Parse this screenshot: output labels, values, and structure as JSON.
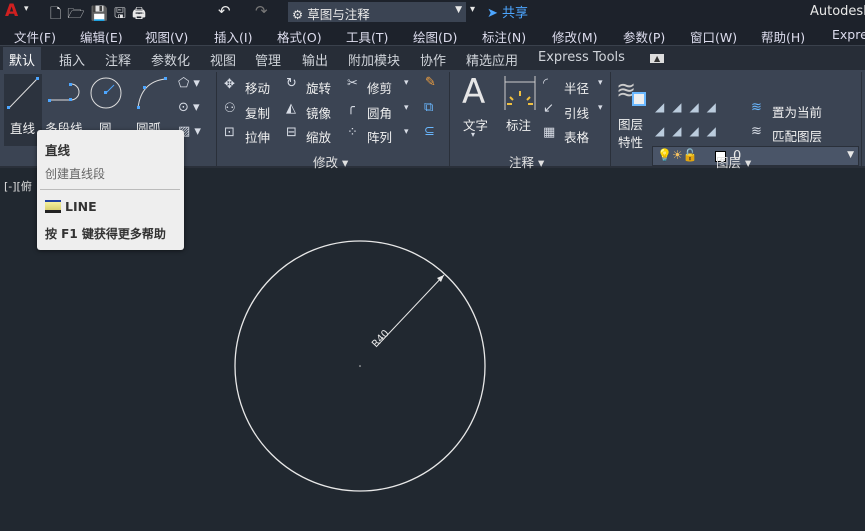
{
  "titlebar": {
    "workspace": "草图与注释",
    "share": "共享",
    "app_title": "Autodesk"
  },
  "menu": [
    "文件(F)",
    "编辑(E)",
    "视图(V)",
    "插入(I)",
    "格式(O)",
    "工具(T)",
    "绘图(D)",
    "标注(N)",
    "修改(M)",
    "参数(P)",
    "窗口(W)",
    "帮助(H)",
    "Expre"
  ],
  "tabs": [
    "默认",
    "插入",
    "注释",
    "参数化",
    "视图",
    "管理",
    "输出",
    "附加模块",
    "协作",
    "精选应用",
    "Express Tools"
  ],
  "draw": {
    "line": "直线",
    "polyline": "多段线",
    "circle": "圆",
    "arc": "圆弧"
  },
  "modify": {
    "move": "移动",
    "rotate": "旋转",
    "trim": "修剪",
    "copy": "复制",
    "mirror": "镜像",
    "fillet": "圆角",
    "stretch": "拉伸",
    "scale": "缩放",
    "array": "阵列",
    "panel": "修改"
  },
  "annotation": {
    "text": "文字",
    "dimension": "标注",
    "radius": "半径",
    "leader": "引线",
    "table": "表格",
    "panel": "注释"
  },
  "layers": {
    "properties_1": "图层",
    "properties_2": "特性",
    "current_layer": "0",
    "set_current": "置为当前",
    "match_layer": "匹配图层",
    "panel": "图层"
  },
  "viewport": {
    "label": "[-][俯"
  },
  "tooltip": {
    "title": "直线",
    "description": "创建直线段",
    "command": "LINE",
    "help": "按 F1 键获得更多帮助"
  },
  "drawing": {
    "dimension_text": "R40"
  },
  "colors": {
    "accent": "#4da6ff",
    "canvas": "#212830",
    "ribbon": "#3b4453"
  }
}
